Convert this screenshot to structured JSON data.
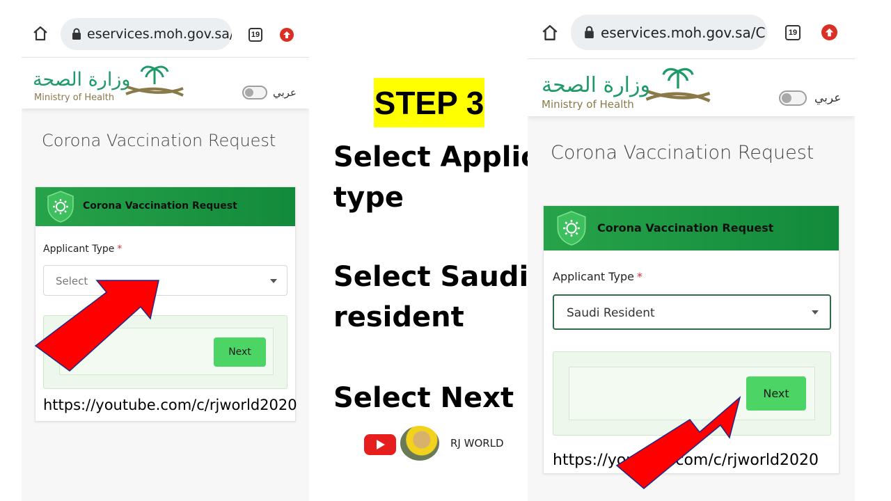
{
  "slide": {
    "step_title": "STEP 3",
    "instructions": [
      "Select Applica",
      "type",
      "Select Saudi",
      "resident",
      "Select Next"
    ],
    "channel_name": "RJ WORLD"
  },
  "browser": {
    "url": "eservices.moh.gov.sa/C",
    "tab_count": "19"
  },
  "site": {
    "logo_arabic": "وزارة الصحة",
    "logo_english": "Ministry of Health",
    "lang_label": "عربي",
    "page_title": "Corona Vaccination Request"
  },
  "form_left": {
    "card_title": "Corona Vaccination Request",
    "field_label": "Applicant Type",
    "required_mark": "*",
    "select_value": "Select",
    "next_label": "Next"
  },
  "form_right": {
    "card_title": "Corona Vaccination Request",
    "field_label": "Applicant Type",
    "required_mark": "*",
    "select_value": "Saudi Resident",
    "next_label": "Next"
  },
  "watermark": "https://youtube.com/c/rjworld2020",
  "colors": {
    "header_green": "#1f9d45",
    "next_green": "#4cd464",
    "step_highlight": "#ffff00",
    "arrow_red": "#ff0000",
    "required_red": "#d32f2f",
    "logo_green": "#1d9a68"
  }
}
